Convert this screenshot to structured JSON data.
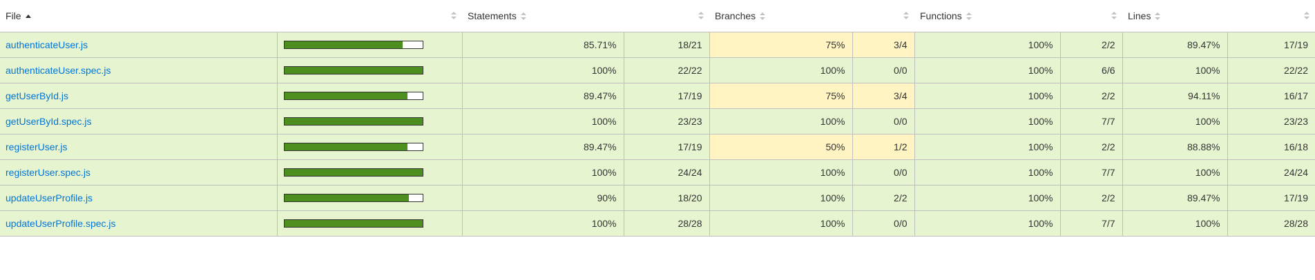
{
  "header": {
    "file": "File",
    "statements": "Statements",
    "branches": "Branches",
    "functions": "Functions",
    "lines": "Lines"
  },
  "colors": {
    "high": "#e6f5d0",
    "medium": "#fff4c2",
    "bar_fill": "#4d8f1e",
    "link": "#0074d9"
  },
  "rows": [
    {
      "file": "authenticateUser.js",
      "coverage_fraction": 0.8571,
      "statements_pct": "85.71%",
      "statements": "18/21",
      "branches_pct": "75%",
      "branches": "3/4",
      "branches_level": "medium",
      "functions_pct": "100%",
      "functions": "2/2",
      "lines_pct": "89.47%",
      "lines": "17/19"
    },
    {
      "file": "authenticateUser.spec.js",
      "coverage_fraction": 1.0,
      "statements_pct": "100%",
      "statements": "22/22",
      "branches_pct": "100%",
      "branches": "0/0",
      "branches_level": "high",
      "functions_pct": "100%",
      "functions": "6/6",
      "lines_pct": "100%",
      "lines": "22/22"
    },
    {
      "file": "getUserById.js",
      "coverage_fraction": 0.8947,
      "statements_pct": "89.47%",
      "statements": "17/19",
      "branches_pct": "75%",
      "branches": "3/4",
      "branches_level": "medium",
      "functions_pct": "100%",
      "functions": "2/2",
      "lines_pct": "94.11%",
      "lines": "16/17"
    },
    {
      "file": "getUserById.spec.js",
      "coverage_fraction": 1.0,
      "statements_pct": "100%",
      "statements": "23/23",
      "branches_pct": "100%",
      "branches": "0/0",
      "branches_level": "high",
      "functions_pct": "100%",
      "functions": "7/7",
      "lines_pct": "100%",
      "lines": "23/23"
    },
    {
      "file": "registerUser.js",
      "coverage_fraction": 0.8947,
      "statements_pct": "89.47%",
      "statements": "17/19",
      "branches_pct": "50%",
      "branches": "1/2",
      "branches_level": "medium",
      "functions_pct": "100%",
      "functions": "2/2",
      "lines_pct": "88.88%",
      "lines": "16/18"
    },
    {
      "file": "registerUser.spec.js",
      "coverage_fraction": 1.0,
      "statements_pct": "100%",
      "statements": "24/24",
      "branches_pct": "100%",
      "branches": "0/0",
      "branches_level": "high",
      "functions_pct": "100%",
      "functions": "7/7",
      "lines_pct": "100%",
      "lines": "24/24"
    },
    {
      "file": "updateUserProfile.js",
      "coverage_fraction": 0.9,
      "statements_pct": "90%",
      "statements": "18/20",
      "branches_pct": "100%",
      "branches": "2/2",
      "branches_level": "high",
      "functions_pct": "100%",
      "functions": "2/2",
      "lines_pct": "89.47%",
      "lines": "17/19"
    },
    {
      "file": "updateUserProfile.spec.js",
      "coverage_fraction": 1.0,
      "statements_pct": "100%",
      "statements": "28/28",
      "branches_pct": "100%",
      "branches": "0/0",
      "branches_level": "high",
      "functions_pct": "100%",
      "functions": "7/7",
      "lines_pct": "100%",
      "lines": "28/28"
    }
  ]
}
